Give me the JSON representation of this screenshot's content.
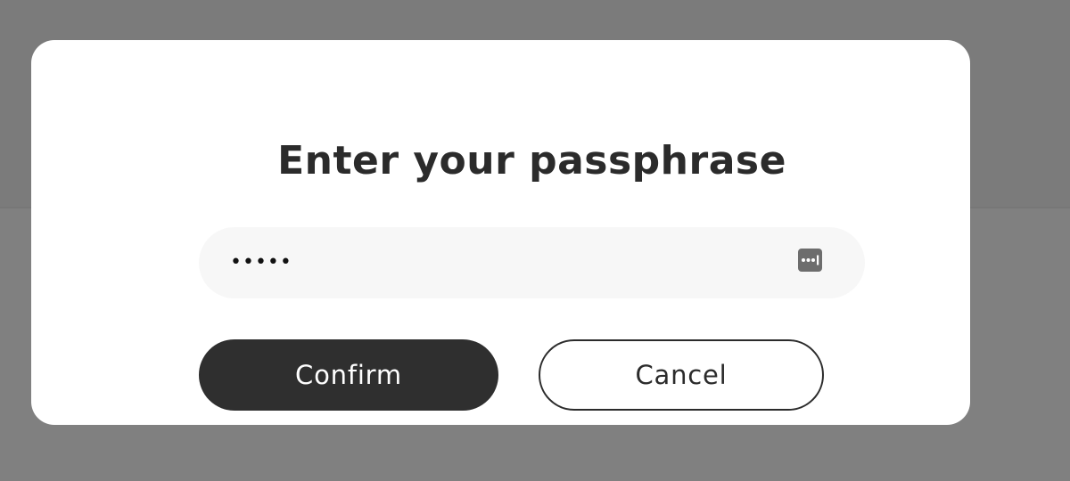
{
  "dialog": {
    "title": "Enter your passphrase",
    "passphrase_field": {
      "value_masked": "•••••",
      "type": "password",
      "icon": "password-manager-icon"
    },
    "buttons": {
      "confirm_label": "Confirm",
      "cancel_label": "Cancel"
    }
  },
  "colors": {
    "overlay": "#7f7f7f",
    "dialog_background": "#ffffff",
    "field_background": "#f7f7f7",
    "primary_button": "#2f2f2f",
    "text": "#2b2b2b"
  }
}
